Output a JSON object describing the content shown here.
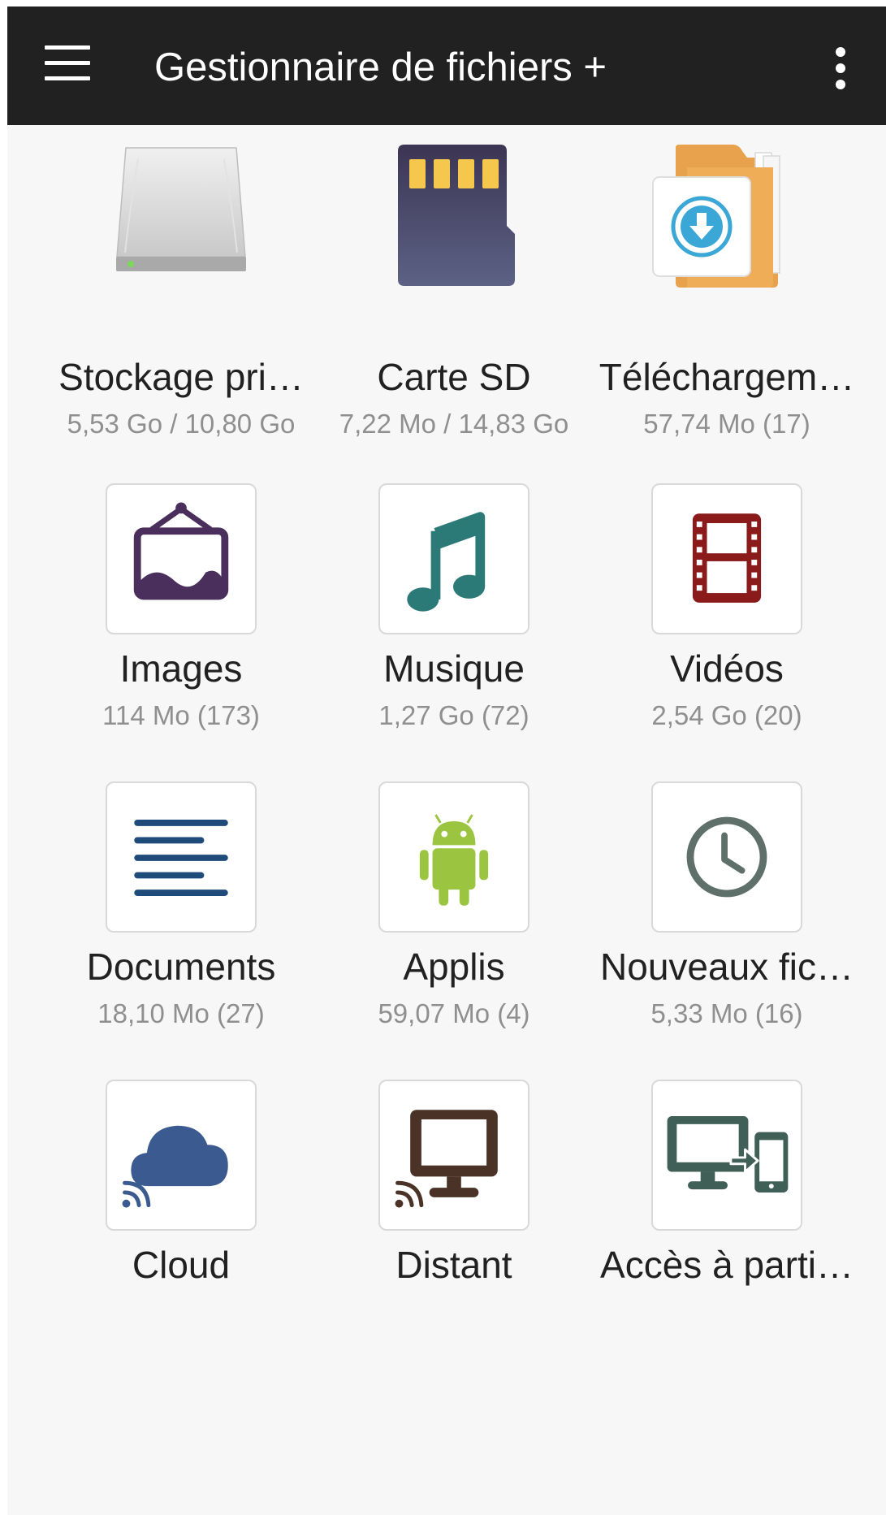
{
  "app_bar": {
    "title": "Gestionnaire de fichiers +",
    "menu_icon": "hamburger-menu-icon",
    "overflow_icon": "more-vertical-icon",
    "background": "#212121"
  },
  "tiles": [
    {
      "label": "Stockage pri…",
      "sub": "5,53 Go / 10,80 Go",
      "icon": "hard-drive-icon"
    },
    {
      "label": "Carte SD",
      "sub": "7,22 Mo / 14,83 Go",
      "icon": "sd-card-icon"
    },
    {
      "label": "Téléchargem…",
      "sub": "57,74 Mo (17)",
      "icon": "downloads-folder-icon"
    },
    {
      "label": "Images",
      "sub": "114 Mo (173)",
      "icon": "picture-frame-icon"
    },
    {
      "label": "Musique",
      "sub": "1,27 Go (72)",
      "icon": "music-note-icon"
    },
    {
      "label": "Vidéos",
      "sub": "2,54 Go (20)",
      "icon": "film-strip-icon"
    },
    {
      "label": "Documents",
      "sub": "18,10 Mo (27)",
      "icon": "document-lines-icon"
    },
    {
      "label": "Applis",
      "sub": "59,07 Mo (4)",
      "icon": "android-icon"
    },
    {
      "label": "Nouveaux fic…",
      "sub": "5,33 Mo (16)",
      "icon": "clock-icon"
    },
    {
      "label": "Cloud",
      "icon": "cloud-icon"
    },
    {
      "label": "Distant",
      "icon": "remote-monitor-icon"
    },
    {
      "label": "Accès à parti…",
      "icon": "pc-to-phone-icon"
    }
  ],
  "colors": {
    "screen_background": "#f7f7f7",
    "label_text": "#212121",
    "sub_text": "#8f8f8f",
    "images_purple": "#4a2e5c",
    "music_teal": "#2b7a78",
    "video_red": "#8b1a1a",
    "documents_blue": "#1f4b7a",
    "android_green": "#9bc541",
    "clock_gray": "#5f6f6a",
    "cloud_blue": "#3b5a8f",
    "remote_brown": "#4a3226",
    "share_green": "#3f5f57",
    "folder_orange": "#e8a14c",
    "download_blue": "#3ba7d6"
  }
}
